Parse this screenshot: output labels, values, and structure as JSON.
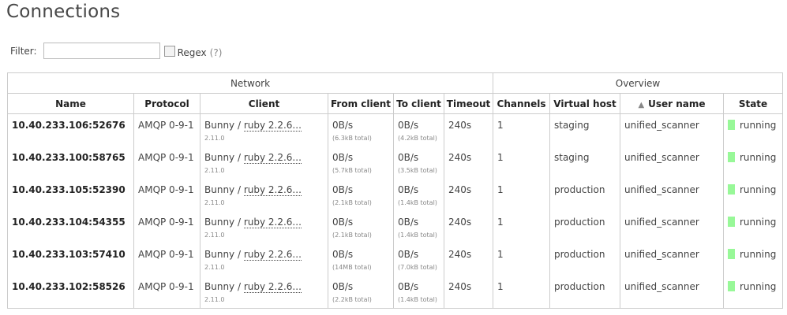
{
  "page": {
    "title": "Connections"
  },
  "filter": {
    "label": "Filter:",
    "value": "",
    "regex_label": "Regex",
    "regex_help": "(?)"
  },
  "groups": {
    "network": "Network",
    "overview": "Overview"
  },
  "columns": {
    "name": "Name",
    "protocol": "Protocol",
    "client": "Client",
    "from_client": "From client",
    "to_client": "To client",
    "timeout": "Timeout",
    "channels": "Channels",
    "virtual_host": "Virtual host",
    "user_name": "User name",
    "state": "State",
    "sort_arrow": "▲"
  },
  "rows": [
    {
      "name": "10.40.233.106:52676",
      "protocol": "AMQP 0-9-1",
      "client_prefix": "Bunny / ",
      "client_version": "ruby 2.2.6...",
      "client_sub": "2.11.0",
      "from": "0B/s",
      "from_total": "(6.3kB total)",
      "to": "0B/s",
      "to_total": "(4.2kB total)",
      "timeout": "240s",
      "channels": "1",
      "vhost": "staging",
      "user": "unified_scanner",
      "state": "running"
    },
    {
      "name": "10.40.233.100:58765",
      "protocol": "AMQP 0-9-1",
      "client_prefix": "Bunny / ",
      "client_version": "ruby 2.2.6...",
      "client_sub": "2.11.0",
      "from": "0B/s",
      "from_total": "(5.7kB total)",
      "to": "0B/s",
      "to_total": "(3.5kB total)",
      "timeout": "240s",
      "channels": "1",
      "vhost": "staging",
      "user": "unified_scanner",
      "state": "running"
    },
    {
      "name": "10.40.233.105:52390",
      "protocol": "AMQP 0-9-1",
      "client_prefix": "Bunny / ",
      "client_version": "ruby 2.2.6...",
      "client_sub": "2.11.0",
      "from": "0B/s",
      "from_total": "(2.1kB total)",
      "to": "0B/s",
      "to_total": "(1.4kB total)",
      "timeout": "240s",
      "channels": "1",
      "vhost": "production",
      "user": "unified_scanner",
      "state": "running"
    },
    {
      "name": "10.40.233.104:54355",
      "protocol": "AMQP 0-9-1",
      "client_prefix": "Bunny / ",
      "client_version": "ruby 2.2.6...",
      "client_sub": "2.11.0",
      "from": "0B/s",
      "from_total": "(2.1kB total)",
      "to": "0B/s",
      "to_total": "(1.4kB total)",
      "timeout": "240s",
      "channels": "1",
      "vhost": "production",
      "user": "unified_scanner",
      "state": "running"
    },
    {
      "name": "10.40.233.103:57410",
      "protocol": "AMQP 0-9-1",
      "client_prefix": "Bunny / ",
      "client_version": "ruby 2.2.6...",
      "client_sub": "2.11.0",
      "from": "0B/s",
      "from_total": "(14MB total)",
      "to": "0B/s",
      "to_total": "(7.0kB total)",
      "timeout": "240s",
      "channels": "1",
      "vhost": "production",
      "user": "unified_scanner",
      "state": "running"
    },
    {
      "name": "10.40.233.102:58526",
      "protocol": "AMQP 0-9-1",
      "client_prefix": "Bunny / ",
      "client_version": "ruby 2.2.6...",
      "client_sub": "2.11.0",
      "from": "0B/s",
      "from_total": "(2.2kB total)",
      "to": "0B/s",
      "to_total": "(1.4kB total)",
      "timeout": "240s",
      "channels": "1",
      "vhost": "production",
      "user": "unified_scanner",
      "state": "running"
    }
  ],
  "colors": {
    "running": "#98f898",
    "border": "#cccccc"
  }
}
